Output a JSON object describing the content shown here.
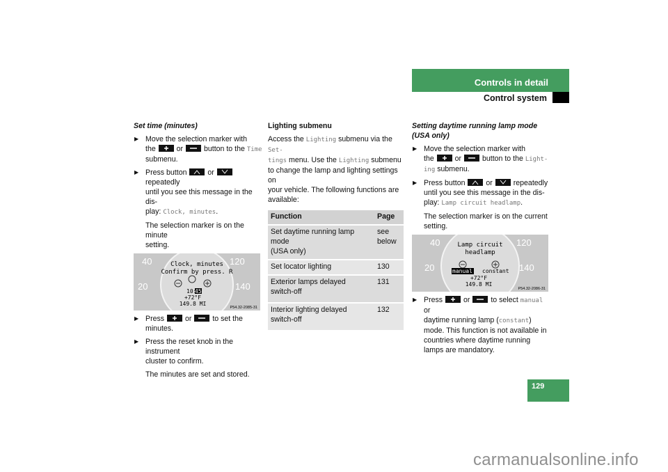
{
  "header": {
    "section": "Controls in detail",
    "subsection": "Control system"
  },
  "page_number": "129",
  "watermark": "carmanualsonline.info",
  "colors": {
    "accent_green": "#449d5f",
    "tab_black": "#000000"
  },
  "icons": {
    "plus": "plus-button-icon",
    "minus": "minus-button-icon",
    "up": "up-button-icon",
    "down": "down-button-icon",
    "bullet": "triangle-right-icon"
  },
  "left": {
    "heading": "Set time (minutes)",
    "s1": {
      "a": "Move the selection marker with",
      "b": "the",
      "or": "or",
      "c": "button to the",
      "mono": "Time",
      "d": "submenu."
    },
    "s2": {
      "a": "Press button",
      "or": "or",
      "b": "repeatedly",
      "c": "until you see this message in the dis-",
      "d": "play:",
      "mono": "Clock, minutes",
      "e": "."
    },
    "n1": {
      "a": "The selection marker is on the minute",
      "b": "setting."
    },
    "gauge": {
      "line1": "Clock, minutes",
      "line2": "Confirm by press. R",
      "time_h": "10:",
      "time_m": "45",
      "temp": "+72°F",
      "odo": "149.8 MI",
      "ref": "P54.32-2085-31",
      "scale": [
        "40",
        "20",
        "120",
        "140"
      ]
    },
    "s3": {
      "a": "Press",
      "or": "or",
      "b": "to set the minutes."
    },
    "s4": {
      "a": "Press the reset knob in the instrument",
      "b": "cluster to confirm."
    },
    "n2": "The minutes are set and stored."
  },
  "middle": {
    "heading": "Lighting submenu",
    "p": {
      "a": "Access the",
      "m1": "Lighting",
      "b": "submenu via the",
      "m2a": "Set-",
      "m2b": "tings",
      "c": "menu. Use the",
      "m3": "Lighting",
      "d": "submenu",
      "e": "to change the lamp and lighting settings on",
      "f": "your vehicle. The following functions are",
      "g": "available:"
    },
    "table": {
      "headers": [
        "Function",
        "Page"
      ],
      "rows": [
        {
          "function": [
            "Set daytime running lamp mode",
            "(USA only)"
          ],
          "page": [
            "see",
            "below"
          ]
        },
        {
          "function": [
            "Set locator lighting"
          ],
          "page": [
            "130"
          ]
        },
        {
          "function": [
            "Exterior lamps delayed",
            "switch-off"
          ],
          "page": [
            "131"
          ]
        },
        {
          "function": [
            "Interior lighting delayed",
            "switch-off"
          ],
          "page": [
            "132"
          ]
        }
      ]
    }
  },
  "right": {
    "heading1": "Setting daytime running lamp mode",
    "heading2": "(USA only)",
    "s1": {
      "a": "Move the selection marker with",
      "b": "the",
      "or": "or",
      "c": "button to the",
      "m1": "Light-",
      "m2": "ing",
      "d": "submenu."
    },
    "s2": {
      "a": "Press button",
      "or": "or",
      "b": "repeatedly",
      "c": "until you see this message in the dis-",
      "d": "play:",
      "mono": "Lamp circuit headlamp",
      "e": "."
    },
    "n1": {
      "a": "The selection marker is on the current",
      "b": "setting."
    },
    "gauge": {
      "line1": "Lamp circuit",
      "line2": "headlamp",
      "opt1": "manual",
      "opt2": "constant",
      "temp": "+72°F",
      "odo": "149.8 MI",
      "ref": "P54.32-2086-31",
      "scale": [
        "40",
        "20",
        "120",
        "140"
      ]
    },
    "s3": {
      "a": "Press",
      "or": "or",
      "b": "to select",
      "m1": "manual",
      "c": "or",
      "d": "daytime running lamp (",
      "m2": "constant",
      "e": ")",
      "f": "mode. This function is not available in",
      "g": "countries where daytime running",
      "h": "lamps are mandatory."
    }
  }
}
